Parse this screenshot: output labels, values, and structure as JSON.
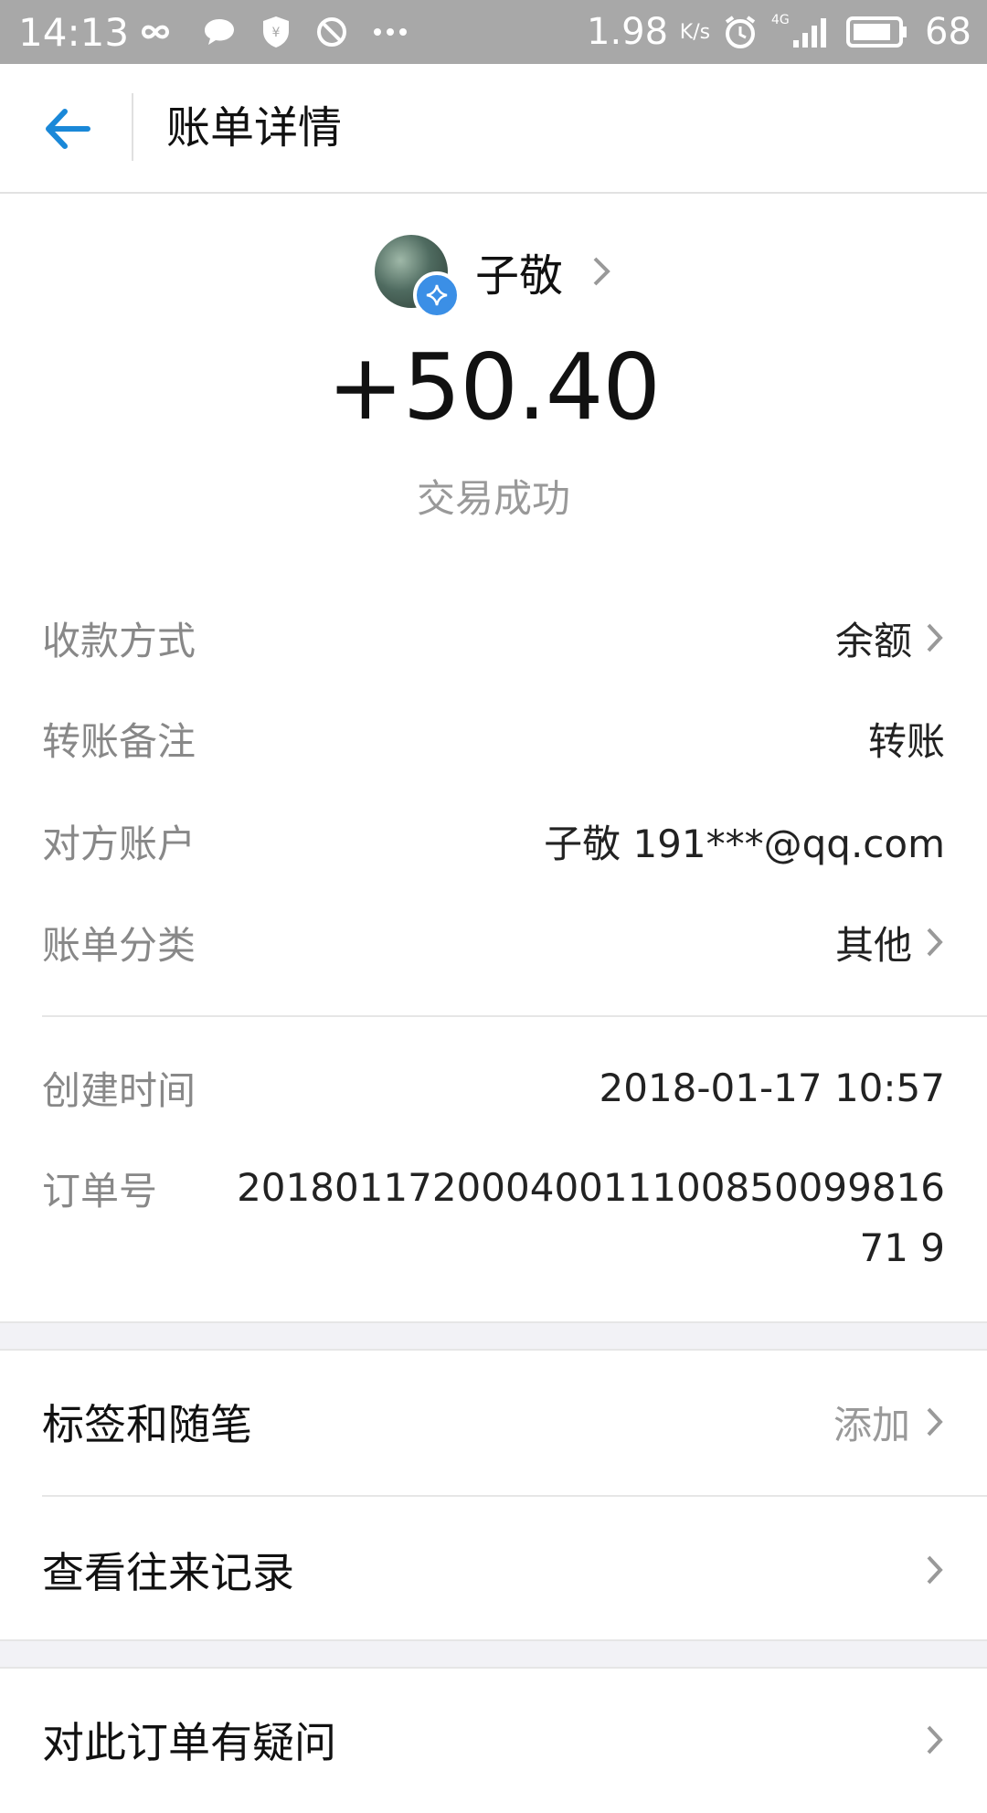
{
  "status_bar": {
    "time": "14:13",
    "net_speed_value": "1.98",
    "net_speed_unit": "K/s",
    "signal_type": "4G",
    "battery": "68",
    "icons": [
      "infinity-icon",
      "chat-bubble-icon",
      "shield-yen-icon",
      "block-icon",
      "more-dots-icon",
      "alarm-icon",
      "signal-icon",
      "battery-icon"
    ]
  },
  "header": {
    "title": "账单详情",
    "accent_color": "#1a88d8"
  },
  "payer": {
    "name": "子敬",
    "amount": "+50.40",
    "status": "交易成功"
  },
  "details": [
    {
      "label": "收款方式",
      "value": "余额",
      "chevron": true
    },
    {
      "label": "转账备注",
      "value": "转账",
      "chevron": false
    },
    {
      "label": "对方账户",
      "value": "子敬 191***@qq.com",
      "chevron": false
    },
    {
      "label": "账单分类",
      "value": "其他",
      "chevron": true
    }
  ],
  "meta": {
    "created_label": "创建时间",
    "created_value": "2018-01-17 10:57",
    "order_label": "订单号",
    "order_value": "2018011720004001110085009981671 9"
  },
  "actions": [
    {
      "label": "标签和随笔",
      "hint": "添加"
    },
    {
      "label": "查看往来记录",
      "hint": ""
    },
    {
      "label": "对此订单有疑问",
      "hint": ""
    }
  ]
}
